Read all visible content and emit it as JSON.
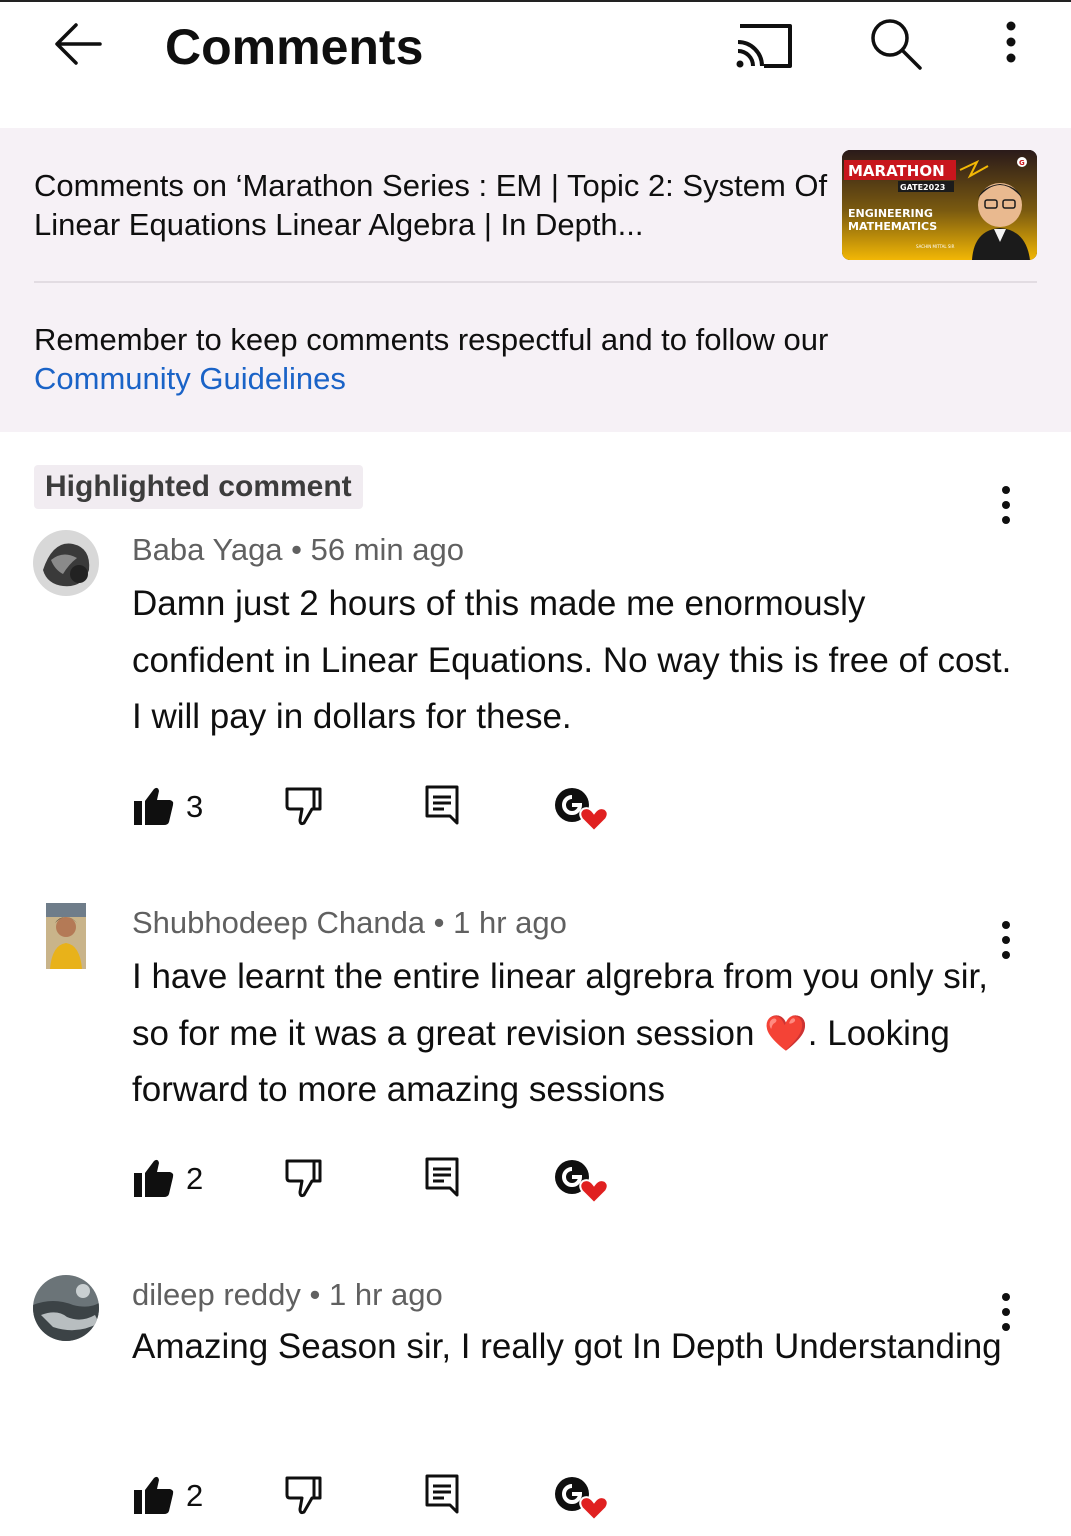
{
  "header": {
    "title": "Comments",
    "icons": [
      "back-arrow-icon",
      "cast-icon",
      "search-icon",
      "more-vert-icon"
    ]
  },
  "video": {
    "comments_on": "Comments on ‘Marathon Series : EM | Topic 2: System Of Linear Equations Linear Algebra | In Depth...",
    "thumbnail": {
      "line1": "MARATHON",
      "line2": "GATE2023",
      "line3": "ENGINEERING",
      "line4": "MATHEMATICS",
      "presenter": "SACHIN MITTAL SIR",
      "colors": {
        "top": "#c8161d",
        "bottom": "#f2b705",
        "bg": "#1b1b1b"
      }
    }
  },
  "notice": {
    "text": "Remember to keep comments respectful and to follow our",
    "link": "Community Guidelines",
    "link_color": "#1a63c7"
  },
  "highlight_label": "Highlighted comment",
  "comments": [
    {
      "author": "Baba Yaga",
      "time": "56 min ago",
      "meta": "Baba Yaga • 56 min ago",
      "text": "Damn just 2 hours of this made me enormously confident in Linear Equations. No way this is free of cost. I will pay in dollars for these.",
      "likes": "3"
    },
    {
      "author": "Shubhodeep Chanda",
      "time": "1 hr ago",
      "meta": "Shubhodeep Chanda • 1 hr ago",
      "text": "I have learnt the entire linear algrebra from you only sir, so for me it was a great revision session ❤️. Looking forward to more amazing sessions",
      "likes": "2"
    },
    {
      "author": "dileep reddy",
      "time": "1 hr ago",
      "meta": "dileep reddy • 1 hr ago",
      "text": "Amazing Season sir, I really got In Depth Understanding",
      "likes": "2"
    }
  ]
}
